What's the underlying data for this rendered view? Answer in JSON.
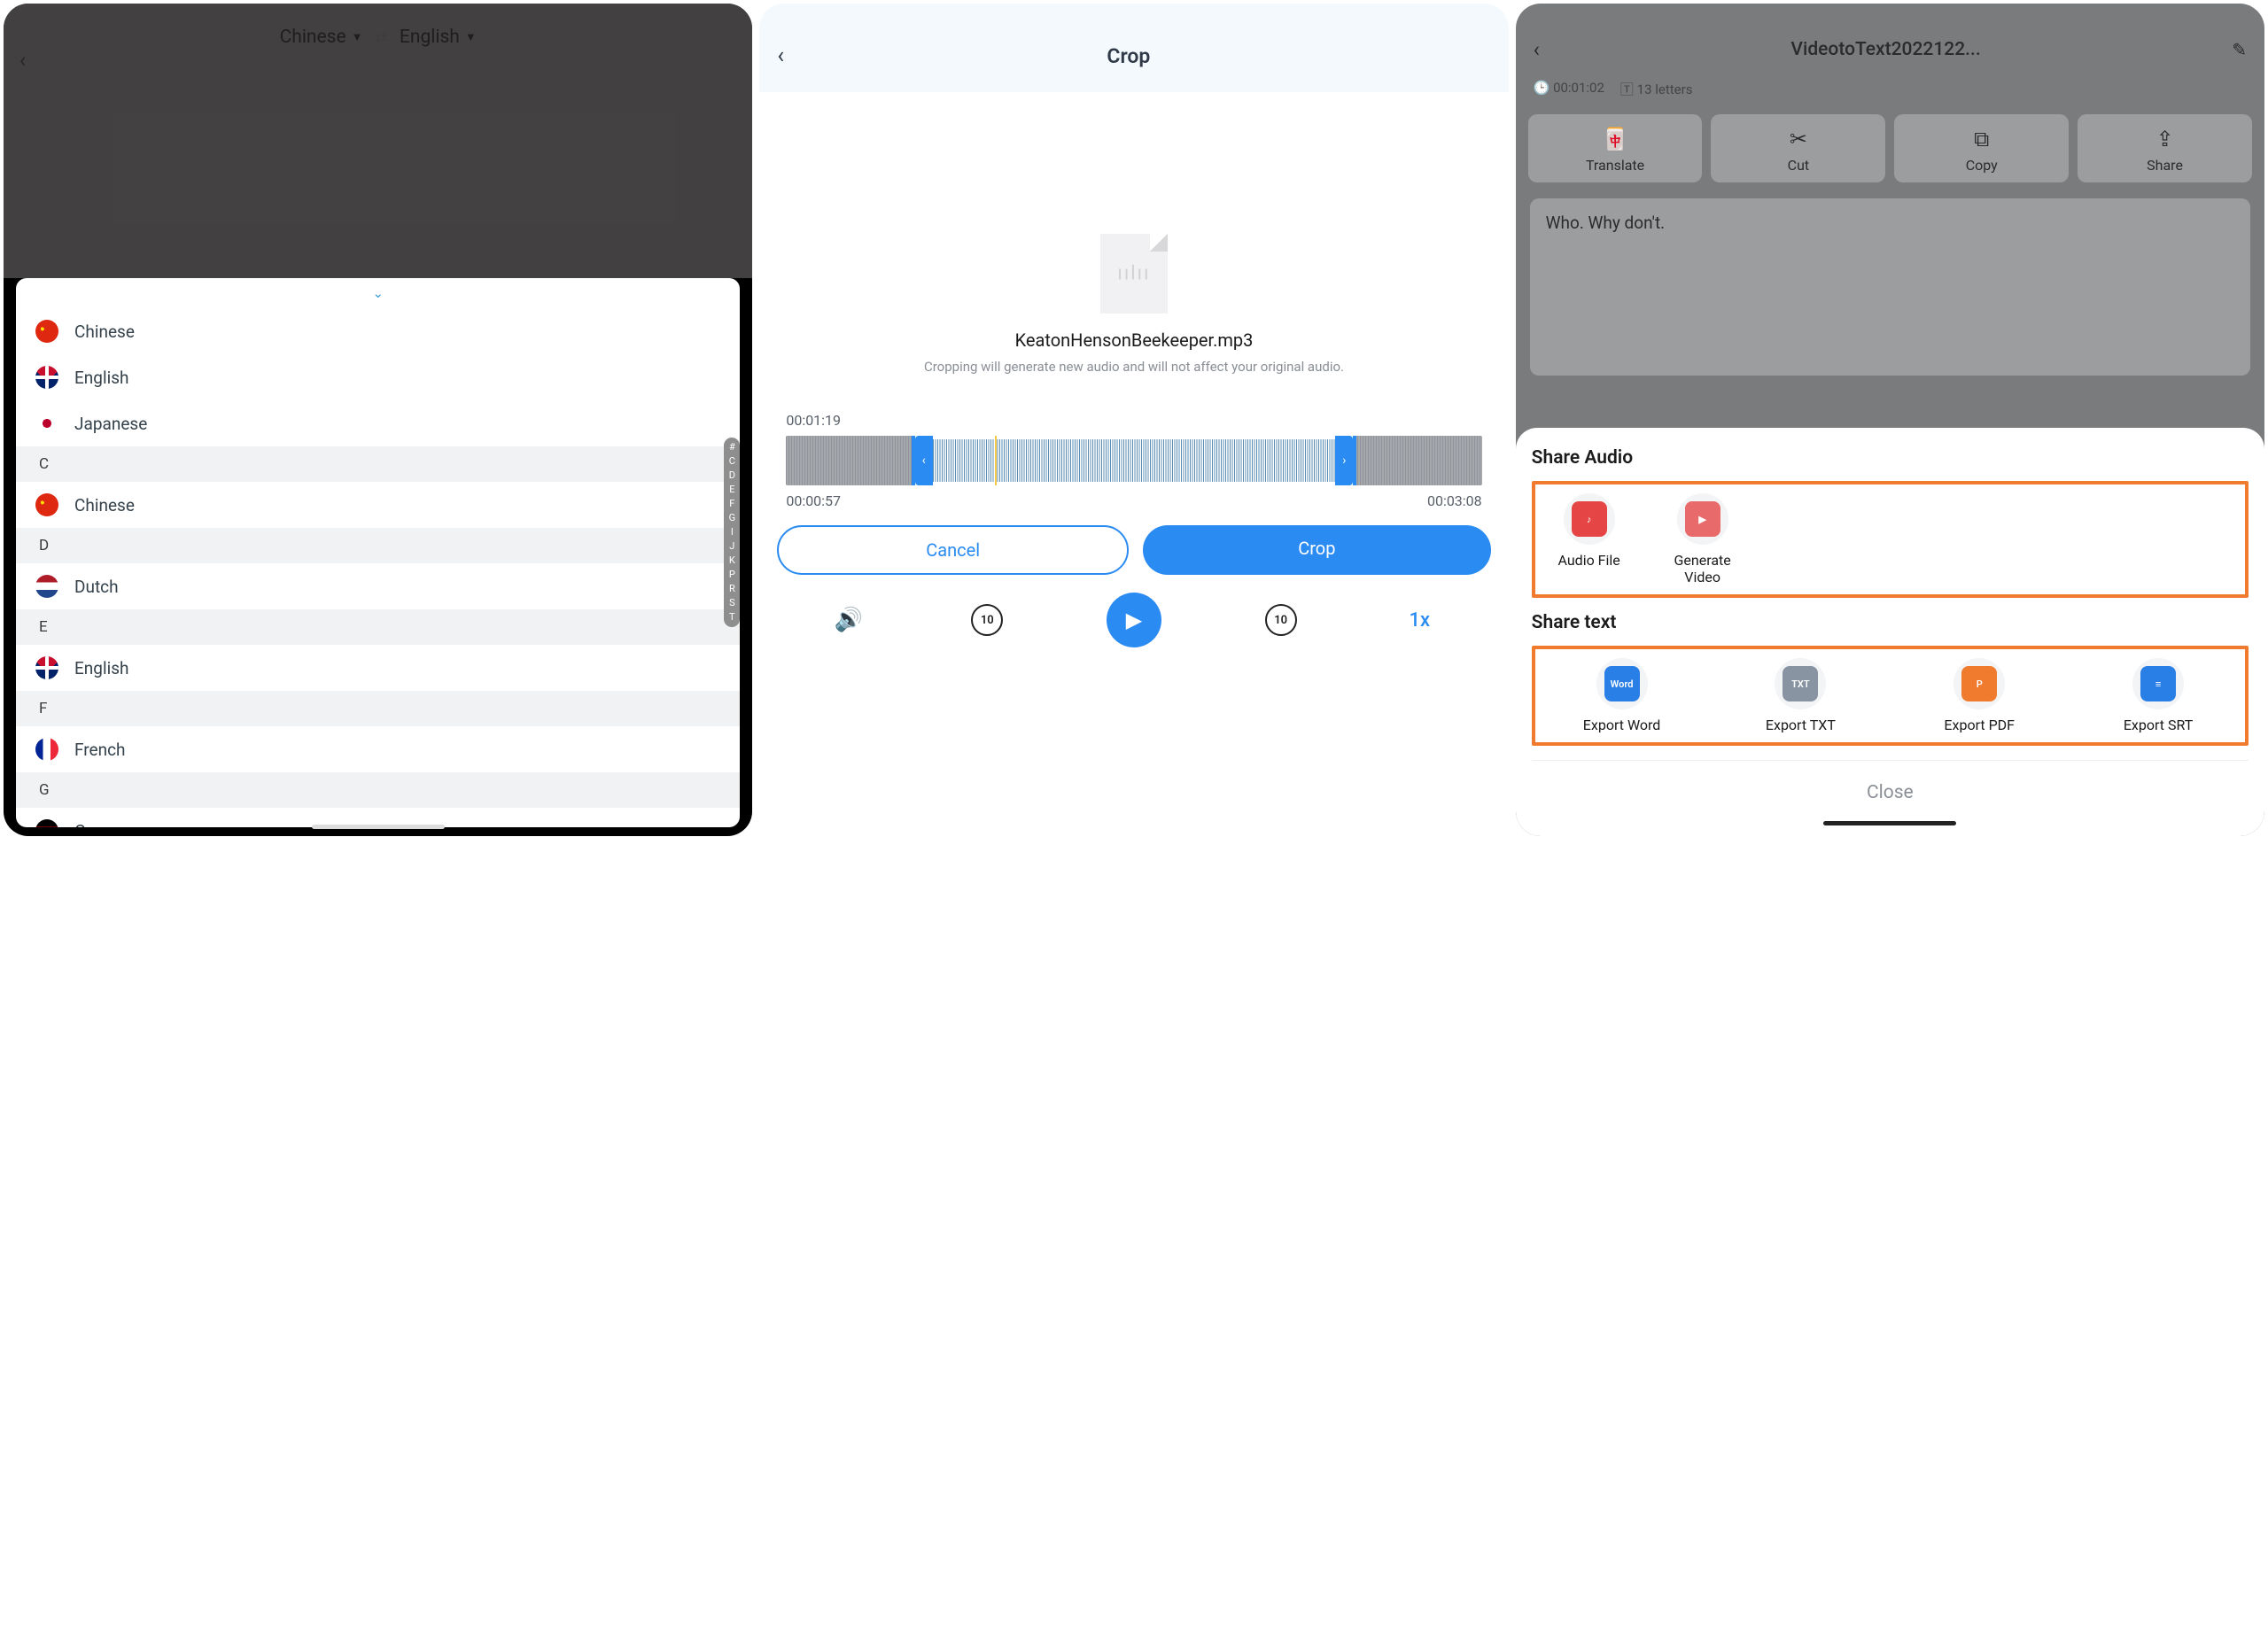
{
  "screen1": {
    "source_lang": "Chinese",
    "target_lang": "English",
    "recent": [
      "Chinese",
      "English",
      "Japanese"
    ],
    "sections": [
      {
        "letter": "C",
        "items": [
          "Chinese"
        ]
      },
      {
        "letter": "D",
        "items": [
          "Dutch"
        ]
      },
      {
        "letter": "E",
        "items": [
          "English"
        ]
      },
      {
        "letter": "F",
        "items": [
          "French"
        ]
      },
      {
        "letter": "G",
        "items": [
          "German"
        ]
      }
    ],
    "index_letters": [
      "#",
      "C",
      "D",
      "E",
      "F",
      "G",
      "I",
      "J",
      "K",
      "P",
      "R",
      "S",
      "T"
    ]
  },
  "screen2": {
    "title": "Crop",
    "filename": "KeatonHensonBeekeeper.mp3",
    "hint": "Cropping will generate new audio and will not affect your original audio.",
    "current_time": "00:01:19",
    "sel_start": "00:00:57",
    "sel_end": "00:03:08",
    "cancel_label": "Cancel",
    "crop_label": "Crop",
    "speed": "1x",
    "skip_sec": "10"
  },
  "screen3": {
    "title": "VideotoText2022122...",
    "duration": "00:01:02",
    "letter_count": "13 letters",
    "actions": [
      "Translate",
      "Cut",
      "Copy",
      "Share"
    ],
    "transcript_text": "Who. Why don't.",
    "share_audio_title": "Share Audio",
    "share_audio_opts": [
      "Audio File",
      "Generate Video"
    ],
    "share_text_title": "Share text",
    "share_text_opts": [
      "Export Word",
      "Export TXT",
      "Export PDF",
      "Export SRT"
    ],
    "close_label": "Close"
  }
}
